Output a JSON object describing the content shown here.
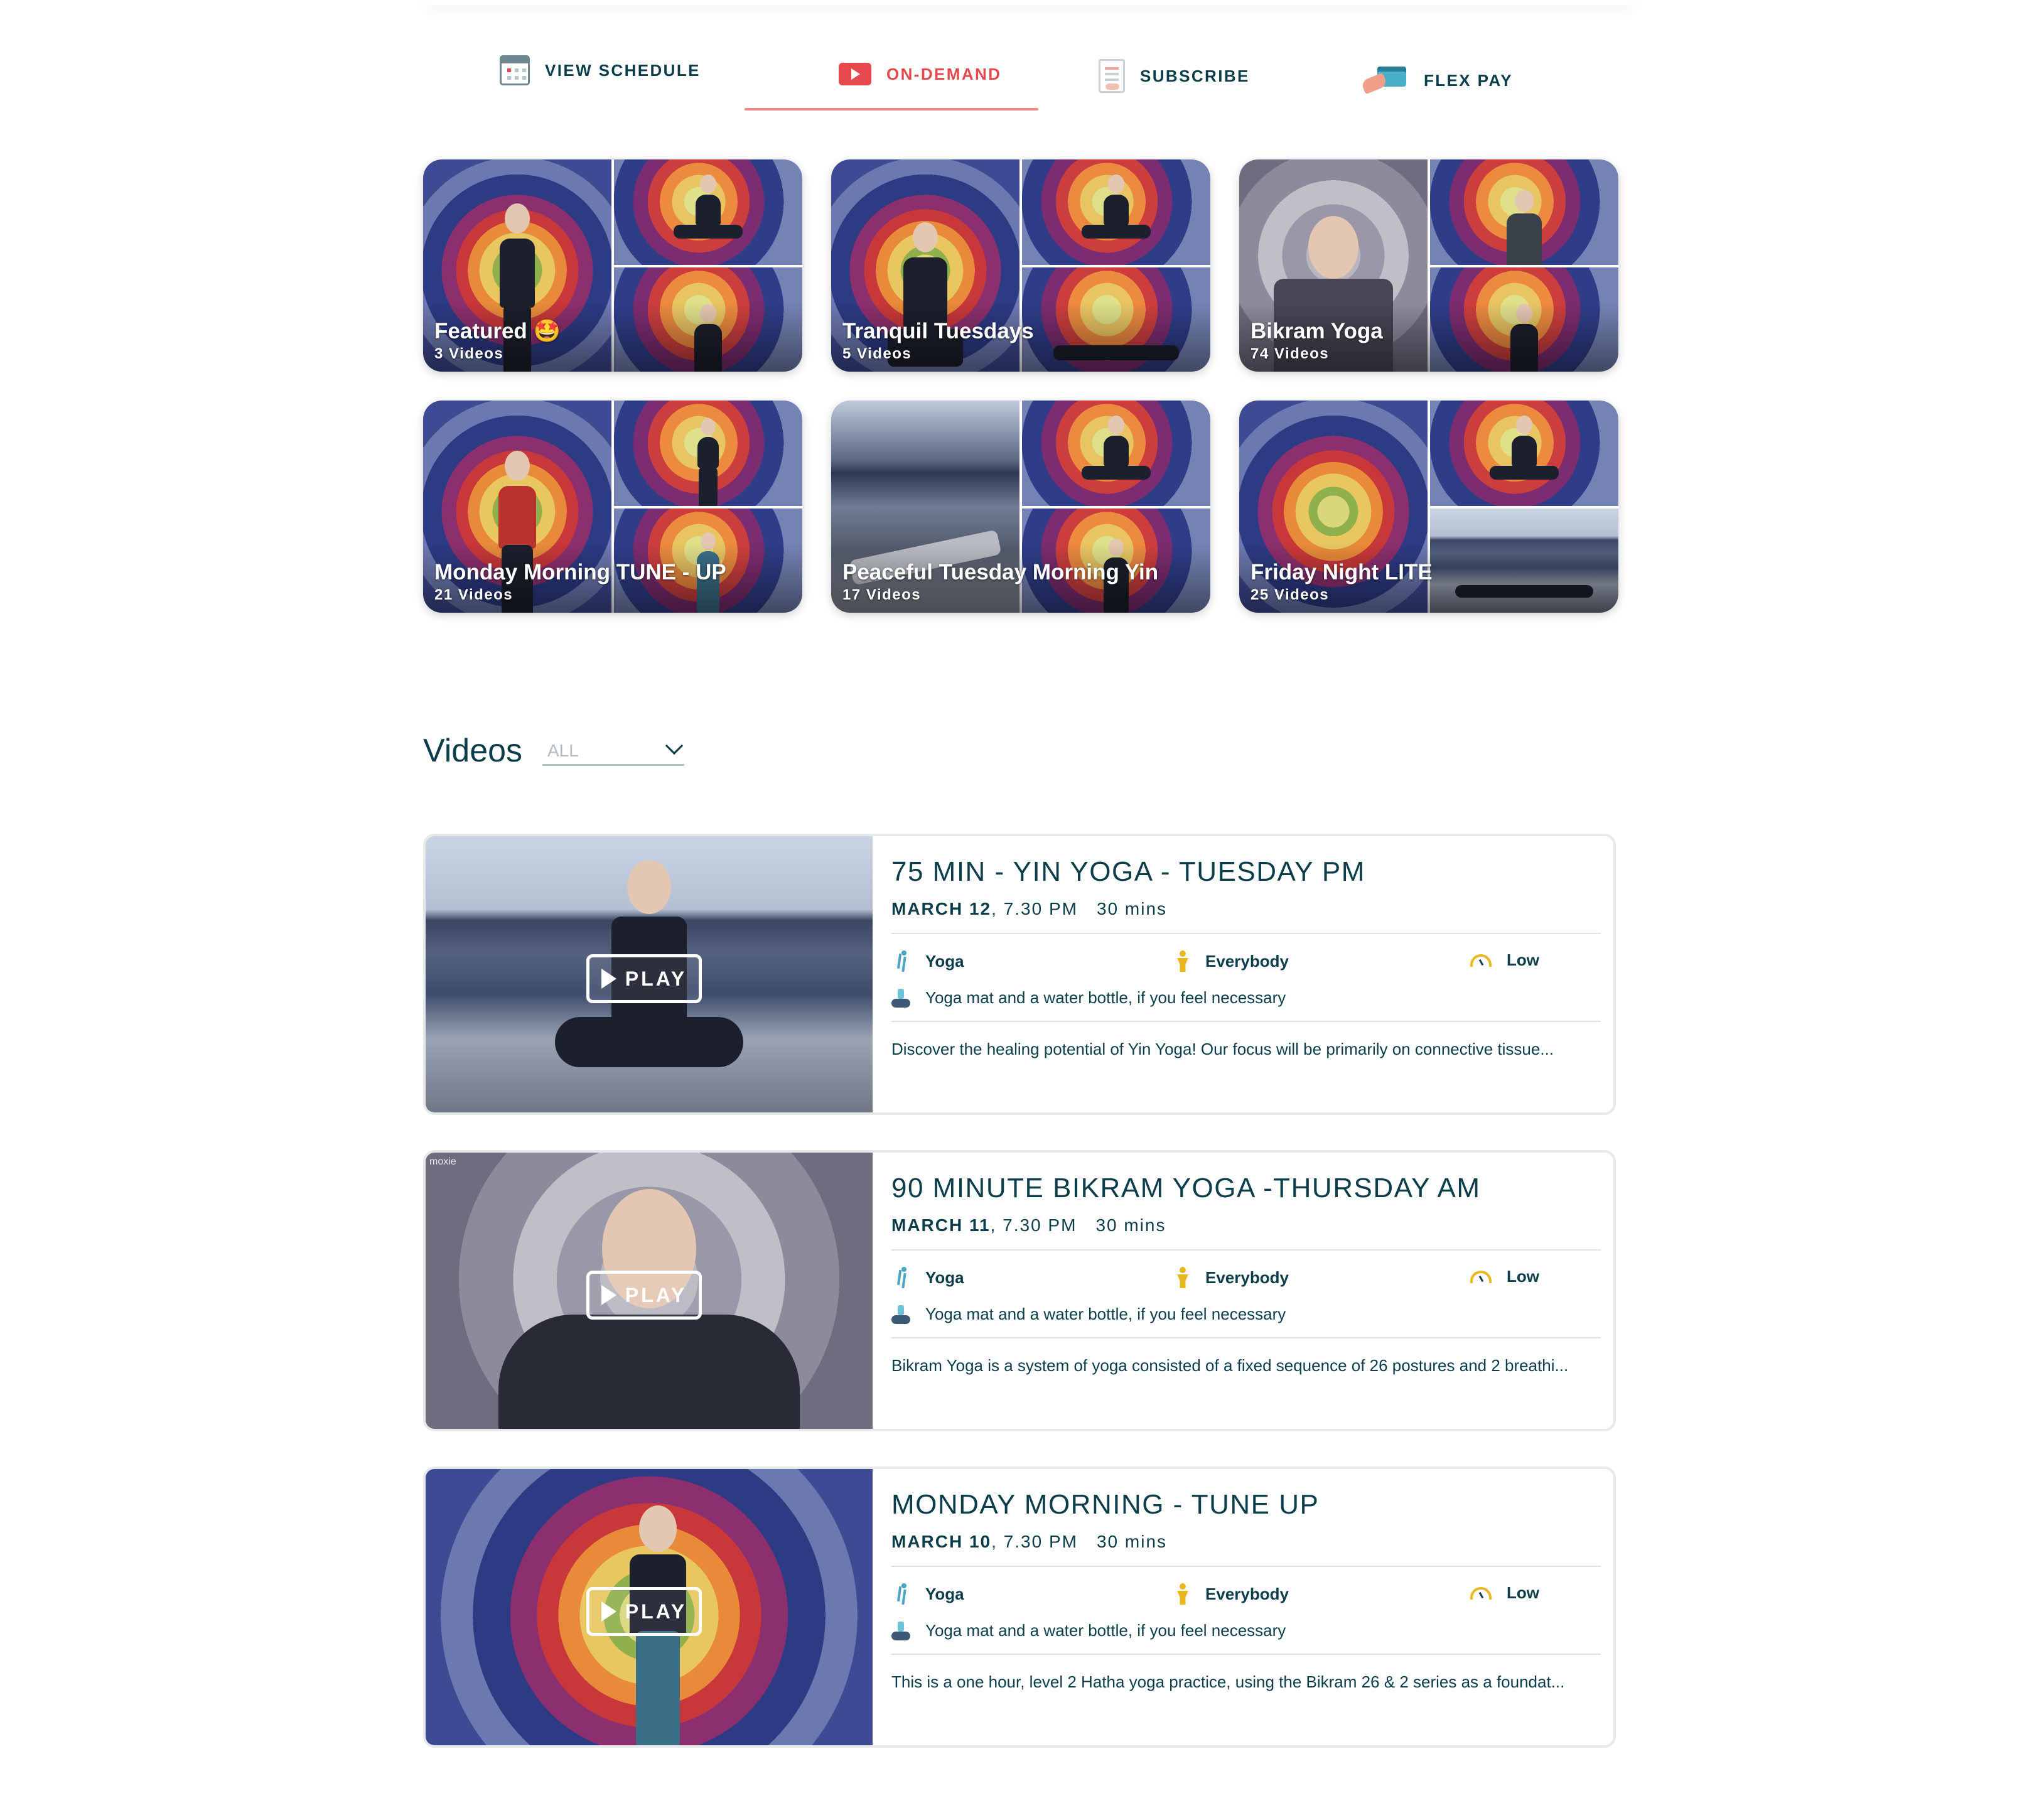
{
  "nav": {
    "tabs": [
      {
        "label": "VIEW SCHEDULE",
        "icon": "calendar-icon"
      },
      {
        "label": "ON-DEMAND",
        "icon": "video-camera-icon",
        "active": true
      },
      {
        "label": "SUBSCRIBE",
        "icon": "document-icon"
      },
      {
        "label": "FLEX PAY",
        "icon": "credit-card-icon"
      }
    ],
    "active_color": "#e5484d"
  },
  "collections": [
    {
      "title": "Featured 🤩",
      "count": "3 Videos"
    },
    {
      "title": "Tranquil Tuesdays",
      "count": "5 Videos"
    },
    {
      "title": "Bikram Yoga",
      "count": "74 Videos"
    },
    {
      "title": "Monday Morning TUNE - UP",
      "count": "21 Videos"
    },
    {
      "title": "Peaceful Tuesday Morning Yin",
      "count": "17 Videos"
    },
    {
      "title": "Friday Night LITE",
      "count": "25 Videos"
    }
  ],
  "videos_section": {
    "heading": "Videos",
    "filter_value": "ALL"
  },
  "videos": [
    {
      "title": "75 MIN - YIN YOGA - TUESDAY PM",
      "date": "MARCH 12",
      "time": ", 7.30 PM",
      "duration": "30 mins",
      "category": "Yoga",
      "audience": "Everybody",
      "intensity": "Low",
      "equipment": "Yoga mat and a water bottle, if you feel necessary",
      "description": "Discover the healing potential of Yin Yoga! Our focus will be primarily on connective tissue...",
      "play_label": "PLAY",
      "watermark": ""
    },
    {
      "title": "90 MINUTE BIKRAM YOGA -THURSDAY AM",
      "date": "MARCH 11",
      "time": ", 7.30 PM",
      "duration": "30 mins",
      "category": "Yoga",
      "audience": "Everybody",
      "intensity": "Low",
      "equipment": "Yoga mat and a water bottle, if you feel necessary",
      "description": "Bikram Yoga is a system of yoga consisted of a fixed sequence of 26 postures and 2 breathi...",
      "play_label": "PLAY",
      "watermark": "moxie"
    },
    {
      "title": "MONDAY MORNING - TUNE UP",
      "date": "MARCH 10",
      "time": ", 7.30 PM",
      "duration": "30 mins",
      "category": "Yoga",
      "audience": "Everybody",
      "intensity": "Low",
      "equipment": "Yoga mat and a water bottle, if you feel necessary",
      "description": "This is a one hour, level 2 Hatha yoga practice, using the Bikram 26 & 2 series as a foundat...",
      "play_label": "PLAY",
      "watermark": ""
    }
  ],
  "colors": {
    "brand_text": "#0c3d4a",
    "accent": "#e5484d",
    "yoga_icon": "#4aa6c4",
    "audience_icon": "#e8b820"
  }
}
